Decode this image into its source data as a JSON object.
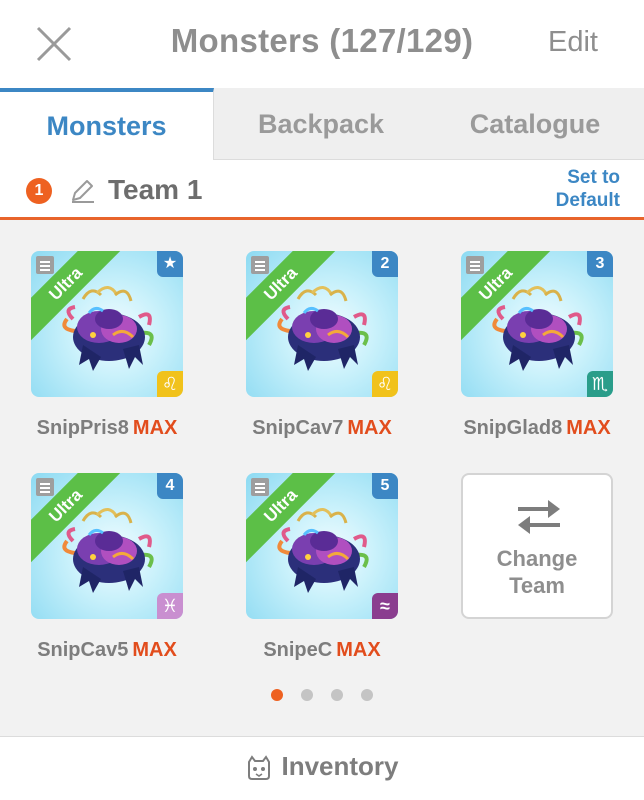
{
  "header": {
    "title": "Monsters (127/129)",
    "edit_label": "Edit",
    "close_icon": "close-icon"
  },
  "tabs": [
    {
      "label": "Monsters",
      "active": true
    },
    {
      "label": "Backpack",
      "active": false
    },
    {
      "label": "Catalogue",
      "active": false
    }
  ],
  "team": {
    "badge": "1",
    "name": "Team 1",
    "set_default_line1": "Set to",
    "set_default_line2": "Default"
  },
  "slots": [
    {
      "name": "SnipPris8",
      "level": "MAX",
      "rarity": "Ultra",
      "slot_label": "★",
      "zodiac": "♌",
      "zodiac_color": "#f1c21b"
    },
    {
      "name": "SnipCav7",
      "level": "MAX",
      "rarity": "Ultra",
      "slot_label": "2",
      "zodiac": "♌",
      "zodiac_color": "#f1c21b"
    },
    {
      "name": "SnipGlad8",
      "level": "MAX",
      "rarity": "Ultra",
      "slot_label": "3",
      "zodiac": "♏",
      "zodiac_color": "#2a9d8a"
    },
    {
      "name": "SnipCav5",
      "level": "MAX",
      "rarity": "Ultra",
      "slot_label": "4",
      "zodiac": "♓",
      "zodiac_color": "#c98fd0"
    },
    {
      "name": "SnipeC",
      "level": "MAX",
      "rarity": "Ultra",
      "slot_label": "5",
      "zodiac": "≈",
      "zodiac_color": "#8a3d8f"
    }
  ],
  "change_team": {
    "line1": "Change",
    "line2": "Team"
  },
  "pagination": {
    "pages": 4,
    "current": 1
  },
  "footer": {
    "label": "Inventory"
  },
  "colors": {
    "accent_blue": "#3c87c4",
    "accent_orange": "#ee6121",
    "max_red": "#e24d1d",
    "ultra_green": "#5cbf47"
  }
}
